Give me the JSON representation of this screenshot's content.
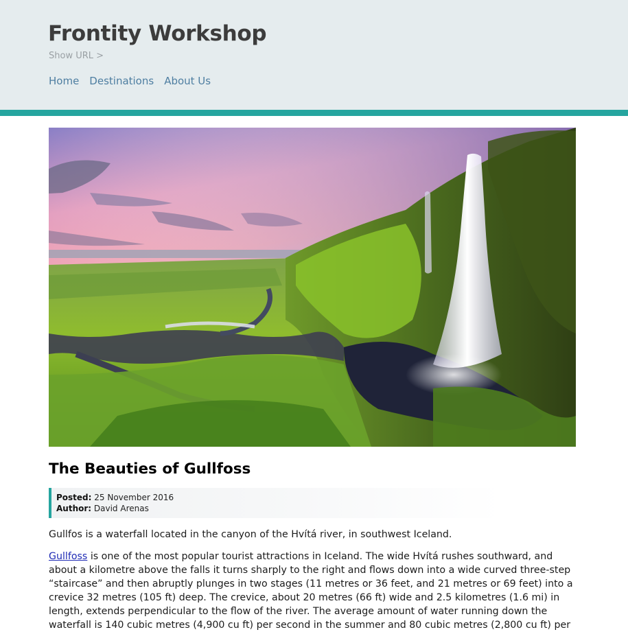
{
  "header": {
    "site_title": "Frontity Workshop",
    "show_url": "Show URL >",
    "nav": [
      "Home",
      "Destinations",
      "About Us"
    ],
    "accent_color": "#25a59f",
    "background_color": "#e5ecee"
  },
  "post": {
    "hero_image": "waterfall-landscape-image",
    "title": "The Beauties of Gullfoss",
    "meta": {
      "posted_label": "Posted:",
      "posted_value": "25 November 2016",
      "author_label": "Author:",
      "author_value": "David Arenas"
    },
    "paragraph1": "Gullfos is a waterfall located in the canyon of the Hvítá river, in southwest Iceland.",
    "paragraph2_link": "Gullfoss",
    "paragraph2_text": " is one of the most popular tourist attractions in Iceland. The wide Hvítá rushes southward, and about a kilometre above the falls it turns sharply to the right and flows down into a wide curved three-step “staircase” and then abruptly plunges in two stages (11 metres or 36 feet, and 21 metres or 69 feet) into a crevice 32 metres (105 ft) deep. The crevice, about 20 metres (66 ft) wide and 2.5 kilometres (1.6 mi) in length, extends perpendicular to the flow of the river. The average amount of water running down the waterfall is 140 cubic metres (4,900 cu ft) per second in the summer and 80 cubic metres (2,800 cu ft) per"
  }
}
